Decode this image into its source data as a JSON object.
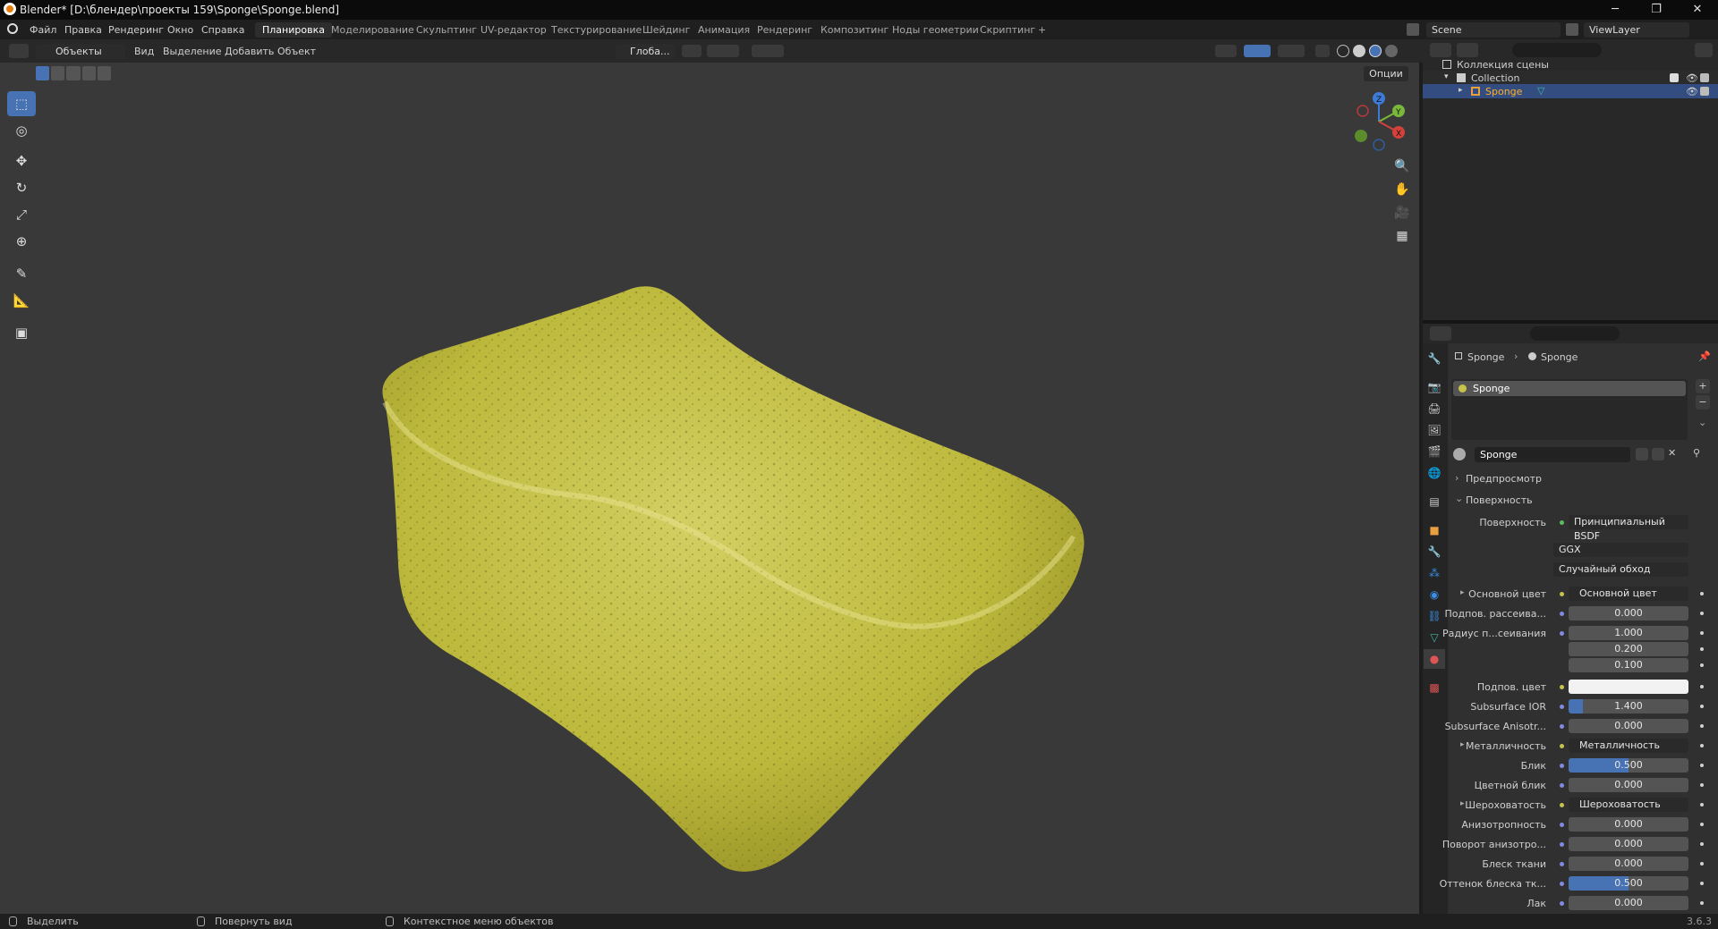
{
  "window": {
    "title": "Blender* [D:\\блендер\\проекты 159\\Sponge\\Sponge.blend]",
    "min": "─",
    "max": "❐",
    "close": "✕"
  },
  "menu": [
    "Файл",
    "Правка",
    "Рендеринг",
    "Окно",
    "Справка"
  ],
  "workspaces": [
    "Планировка",
    "Моделирование",
    "Скульптинг",
    "UV-редактор",
    "Текстурирование",
    "Шейдинг",
    "Анимация",
    "Рендеринг",
    "Композитинг",
    "Ноды геометрии",
    "Скриптинг",
    "+"
  ],
  "active_workspace": "Планировка",
  "scene": "Scene",
  "view_layer": "ViewLayer",
  "viewport_header": {
    "mode": "Объекты",
    "menus": [
      "Вид",
      "Выделение",
      "Добавить",
      "Объект"
    ],
    "orientation": "Глоба...",
    "options": "Опции"
  },
  "toolbar_tools": [
    "select-box",
    "cursor",
    "move",
    "rotate",
    "scale",
    "transform",
    "annotate",
    "measure",
    "add-cube"
  ],
  "gizmo": {
    "x": "X",
    "y": "Y",
    "z": "Z"
  },
  "outliner": {
    "root": "Коллекция сцены",
    "collection": "Collection",
    "object": "Sponge"
  },
  "properties": {
    "breadcrumb": [
      "Sponge",
      "Sponge"
    ],
    "material_slot": "Sponge",
    "material_name": "Sponge",
    "panels": {
      "preview": "Предпросмотр",
      "surface": "Поверхность"
    },
    "surface_shader_label": "Поверхность",
    "surface_shader": "Принципиальный BSDF",
    "distribution": "GGX",
    "subsurface_method": "Случайный обход",
    "rows": [
      {
        "label": "Основной цвет",
        "value": "Основной цвет",
        "kind": "link"
      },
      {
        "label": "Подпов. рассеива...",
        "value": "0.000",
        "kind": "num"
      },
      {
        "label": "Радиус п...сеивания",
        "value": "1.000",
        "kind": "num"
      },
      {
        "label": "",
        "value": "0.200",
        "kind": "num"
      },
      {
        "label": "",
        "value": "0.100",
        "kind": "num"
      },
      {
        "label": "Подпов. цвет",
        "value": "",
        "kind": "color"
      },
      {
        "label": "Subsurface IOR",
        "value": "1.400",
        "kind": "num"
      },
      {
        "label": "Subsurface Anisotr...",
        "value": "0.000",
        "kind": "num"
      },
      {
        "label": "Металличность",
        "value": "Металличность",
        "kind": "link"
      },
      {
        "label": "Блик",
        "value": "0.500",
        "kind": "slider"
      },
      {
        "label": "Цветной блик",
        "value": "0.000",
        "kind": "num"
      },
      {
        "label": "Шероховатость",
        "value": "Шероховатость",
        "kind": "link"
      },
      {
        "label": "Анизотропность",
        "value": "0.000",
        "kind": "num"
      },
      {
        "label": "Поворот анизотро...",
        "value": "0.000",
        "kind": "num"
      },
      {
        "label": "Блеск ткани",
        "value": "0.000",
        "kind": "num"
      },
      {
        "label": "Оттенок блеска тк...",
        "value": "0.500",
        "kind": "slider"
      },
      {
        "label": "Лак",
        "value": "0.000",
        "kind": "num"
      }
    ]
  },
  "status": {
    "select": "Выделить",
    "rotate": "Повернуть вид",
    "context": "Контекстное меню объектов",
    "version": "3.6.3"
  },
  "colors": {
    "accent": "#4772b3",
    "sponge": "#c7c34a",
    "viewport_bg": "#393939"
  }
}
